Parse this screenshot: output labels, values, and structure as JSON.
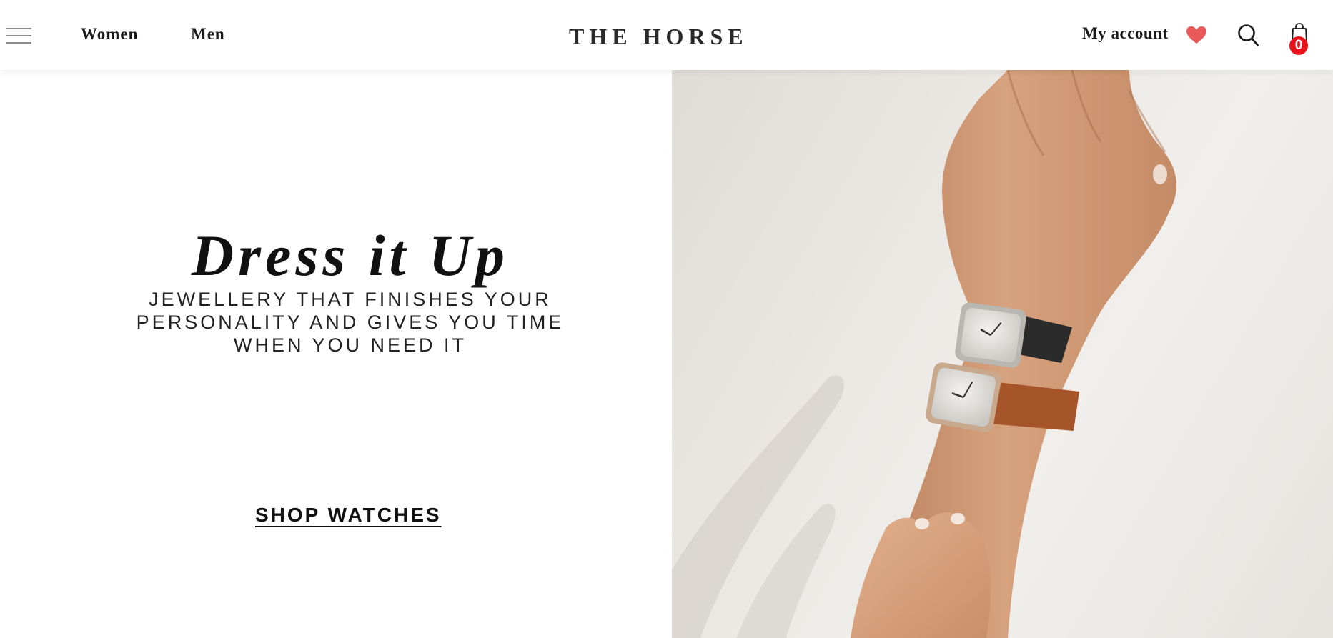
{
  "header": {
    "menu_icon": "hamburger-menu-icon",
    "nav": [
      {
        "label": "Women"
      },
      {
        "label": "Men"
      }
    ],
    "brand": "THE HORSE",
    "account_label": "My account",
    "wishlist_icon": "heart-icon",
    "search_icon": "search-icon",
    "cart_icon": "shopping-bag-icon",
    "cart_count": "0"
  },
  "hero": {
    "headline": "Dress it Up",
    "subheadline": "JEWELLERY THAT FINISHES YOUR PERSONALITY AND GIVES YOU TIME WHEN YOU NEED IT",
    "cta_label": "SHOP WATCHES"
  },
  "colors": {
    "accent_heart": "#e85a5a",
    "badge": "#e8121a",
    "text": "#111111",
    "background": "#ffffff"
  }
}
